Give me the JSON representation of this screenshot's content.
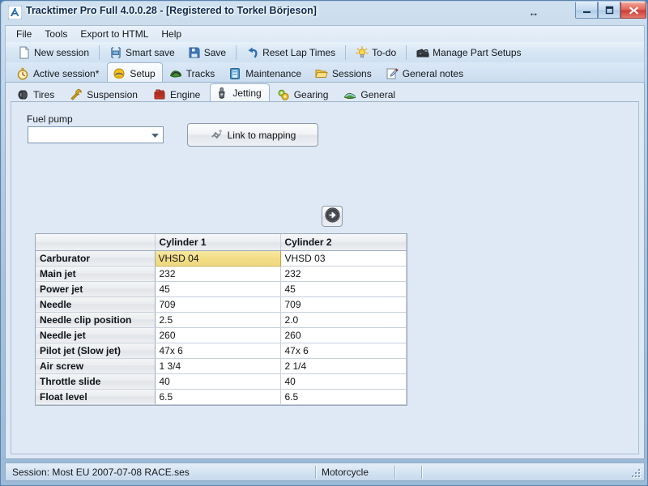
{
  "window": {
    "title": "Tracktimer Pro Full 4.0.0.28  - [Registered to Torkel Börjeson]",
    "app_icon": "app-logo-icon",
    "cursor_glyph": "↔",
    "controls": {
      "minimize": "minimize-icon",
      "maximize": "maximize-icon",
      "close": "close-icon"
    },
    "accent_color": "#2b5d91",
    "close_color": "#cf3b34",
    "client_bg": "#dfe9f5"
  },
  "menu": {
    "items": [
      {
        "label": "File"
      },
      {
        "label": "Tools"
      },
      {
        "label": "Export to HTML"
      },
      {
        "label": "Help"
      }
    ]
  },
  "toolbar": {
    "buttons": [
      {
        "label": "New session",
        "icon": "new-document-icon"
      },
      {
        "label": "Smart save",
        "icon": "smart-save-icon"
      },
      {
        "label": "Save",
        "icon": "floppy-disk-icon"
      },
      {
        "label": "Reset Lap Times",
        "icon": "undo-arrow-icon"
      },
      {
        "label": "To-do",
        "icon": "lightbulb-icon"
      },
      {
        "label": "Manage Part Setups",
        "icon": "toolbox-parts-icon"
      }
    ]
  },
  "tabs": {
    "selected": "Setup",
    "items": [
      {
        "label": "Active session*",
        "icon": "stopwatch-icon"
      },
      {
        "label": "Setup",
        "icon": "helmet-icon"
      },
      {
        "label": "Tracks",
        "icon": "track-icon"
      },
      {
        "label": "Maintenance",
        "icon": "toolbox-icon"
      },
      {
        "label": "Sessions",
        "icon": "folder-open-icon"
      },
      {
        "label": "General notes",
        "icon": "pencil-note-icon"
      }
    ]
  },
  "subtabs": {
    "selected": "Jetting",
    "items": [
      {
        "label": "Tires",
        "icon": "tire-icon"
      },
      {
        "label": "Suspension",
        "icon": "wrench-icon"
      },
      {
        "label": "Engine",
        "icon": "engine-icon"
      },
      {
        "label": "Jetting",
        "icon": "carburetor-icon"
      },
      {
        "label": "Gearing",
        "icon": "gears-icon"
      },
      {
        "label": "General",
        "icon": "general-icon"
      }
    ]
  },
  "setup_panel": {
    "fuel_pump_label": "Fuel pump",
    "fuel_pump_value": "",
    "fuel_pump_placeholder": "",
    "link_button_label": "Link to mapping",
    "link_button_icon": "broken-link-icon",
    "go_button_icon": "arrow-right-circle-icon",
    "highlight_color": "#f2dc85"
  },
  "jetting_grid": {
    "columns": [
      "",
      "Cylinder 1",
      "Cylinder 2"
    ],
    "highlighted_cell": {
      "row": "Carburator",
      "column": "Cylinder 1"
    },
    "rows": [
      {
        "name": "Carburator",
        "cyl1": "VHSD 04",
        "cyl2": "VHSD 03"
      },
      {
        "name": "Main jet",
        "cyl1": "232",
        "cyl2": "232"
      },
      {
        "name": "Power jet",
        "cyl1": "45",
        "cyl2": "45"
      },
      {
        "name": "Needle",
        "cyl1": "709",
        "cyl2": "709"
      },
      {
        "name": "Needle clip position",
        "cyl1": "2.5",
        "cyl2": "2.0"
      },
      {
        "name": "Needle jet",
        "cyl1": "260",
        "cyl2": "260"
      },
      {
        "name": "Pilot jet (Slow jet)",
        "cyl1": "47x 6",
        "cyl2": "47x 6"
      },
      {
        "name": "Air screw",
        "cyl1": "1 3/4",
        "cyl2": "2 1/4"
      },
      {
        "name": "Throttle slide",
        "cyl1": "40",
        "cyl2": "40"
      },
      {
        "name": "Float level",
        "cyl1": "6.5",
        "cyl2": "6.5"
      }
    ]
  },
  "statusbar": {
    "session": "Session: Most EU 2007-07-08 RACE.ses",
    "vehicle_type": "Motorcycle",
    "cell3": "",
    "cell4": "",
    "grip_icon": "resize-grip-icon"
  }
}
